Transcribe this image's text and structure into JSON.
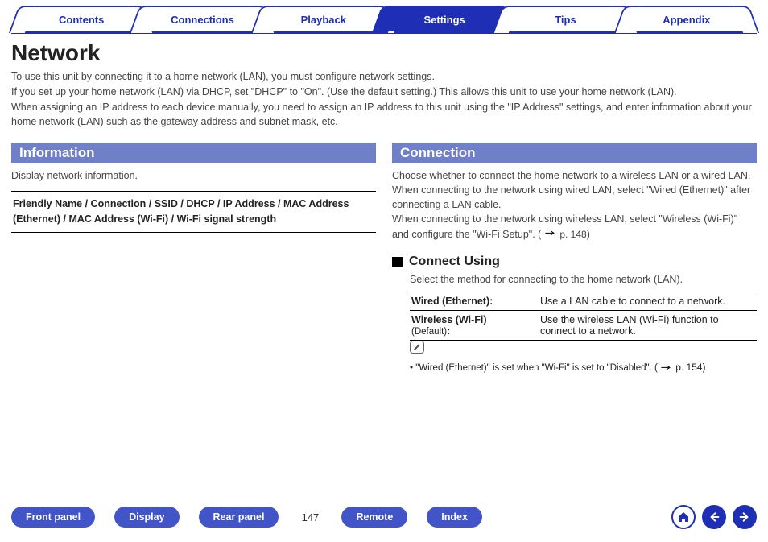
{
  "tabs": {
    "contents": "Contents",
    "connections": "Connections",
    "playback": "Playback",
    "settings": "Settings",
    "tips": "Tips",
    "appendix": "Appendix"
  },
  "title": "Network",
  "intro": {
    "l1": "To use this unit by connecting it to a home network (LAN), you must configure network settings.",
    "l2": "If you set up your home network (LAN) via DHCP, set \"DHCP\" to \"On\". (Use the default setting.) This allows this unit to use your home network (LAN).",
    "l3": "When assigning an IP address to each device manually, you need to assign an IP address to this unit using the \"IP Address\" settings, and enter information about your home network (LAN) such as the gateway address and subnet mask, etc."
  },
  "left": {
    "head": "Information",
    "desc": "Display network information.",
    "params": "Friendly Name / Connection / SSID / DHCP / IP Address / MAC Address (Ethernet) / MAC Address (Wi-Fi) / Wi-Fi signal strength"
  },
  "right": {
    "head": "Connection",
    "p1": "Choose whether to connect the home network to a wireless LAN or a wired LAN.",
    "p2": "When connecting to the network using wired LAN, select \"Wired (Ethernet)\" after connecting a LAN cable.",
    "p3a": "When connecting to the network using wireless LAN, select \"Wireless (Wi-Fi)\" and configure the \"Wi-Fi Setup\". (",
    "p3ref": "p. 148",
    "p3b": ")",
    "sub": "Connect Using",
    "subdesc": "Select the method for connecting to the home network (LAN).",
    "row1a": "Wired (Ethernet):",
    "row1b": "Use a LAN cable to connect to a network.",
    "row2a": "Wireless (Wi-Fi)",
    "row2def": "(Default)",
    "row2colon": ":",
    "row2b": "Use the wireless LAN (Wi-Fi) function to connect to a network.",
    "note": "\"Wired (Ethernet)\" is set when \"Wi-Fi\" is set to \"Disabled\".  (",
    "noteref": "p. 154",
    "noteb": ")"
  },
  "bottom": {
    "frontpanel": "Front panel",
    "display": "Display",
    "rearpanel": "Rear panel",
    "page": "147",
    "remote": "Remote",
    "index": "Index"
  }
}
